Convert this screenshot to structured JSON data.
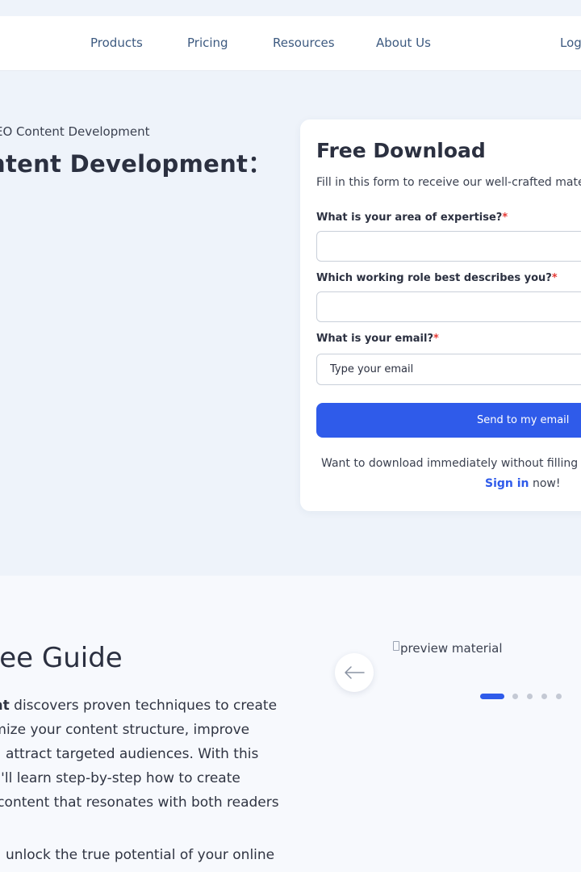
{
  "nav": {
    "items": [
      {
        "label": "Products"
      },
      {
        "label": "Pricing"
      },
      {
        "label": "Resources"
      },
      {
        "label": "About Us"
      }
    ],
    "login_label": "Log"
  },
  "hero": {
    "breadcrumb": "EO Content Development",
    "title": "ntent Development："
  },
  "form": {
    "title": "Free Download",
    "subtitle": "Fill in this form to receive our well-crafted mate",
    "fields": [
      {
        "label": "What is your area of expertise?",
        "required_mark": "*"
      },
      {
        "label": "Which working role best describes you?",
        "required_mark": "*"
      },
      {
        "label": "What is your email?",
        "required_mark": "*",
        "placeholder": "Type your email",
        "value": ""
      }
    ],
    "submit_label": "Send to my email",
    "want_text": "Want to download immediately without filling",
    "signin_label": "Sign in",
    "signin_suffix": " now!"
  },
  "guide": {
    "title": "ree Guide",
    "lines": [
      {
        "bold": "ent",
        "text": " discovers proven techniques to create"
      },
      {
        "bold": "",
        "text": "timize your content structure, improve"
      },
      {
        "bold": "",
        "text": "nd attract targeted audiences. With this"
      },
      {
        "bold": "",
        "text": "ou'll learn step-by-step how to create"
      },
      {
        "bold": "",
        "text": "d content that resonates with both readers"
      },
      {
        "bold": "",
        "text": "nd unlock the true potential of your online"
      }
    ]
  },
  "carousel": {
    "image_alt": "preview material",
    "slide_count": 5,
    "active_index": 0
  },
  "colors": {
    "accent": "#2f5bea",
    "required": "#e53935",
    "nav_text": "#3d5a80"
  }
}
